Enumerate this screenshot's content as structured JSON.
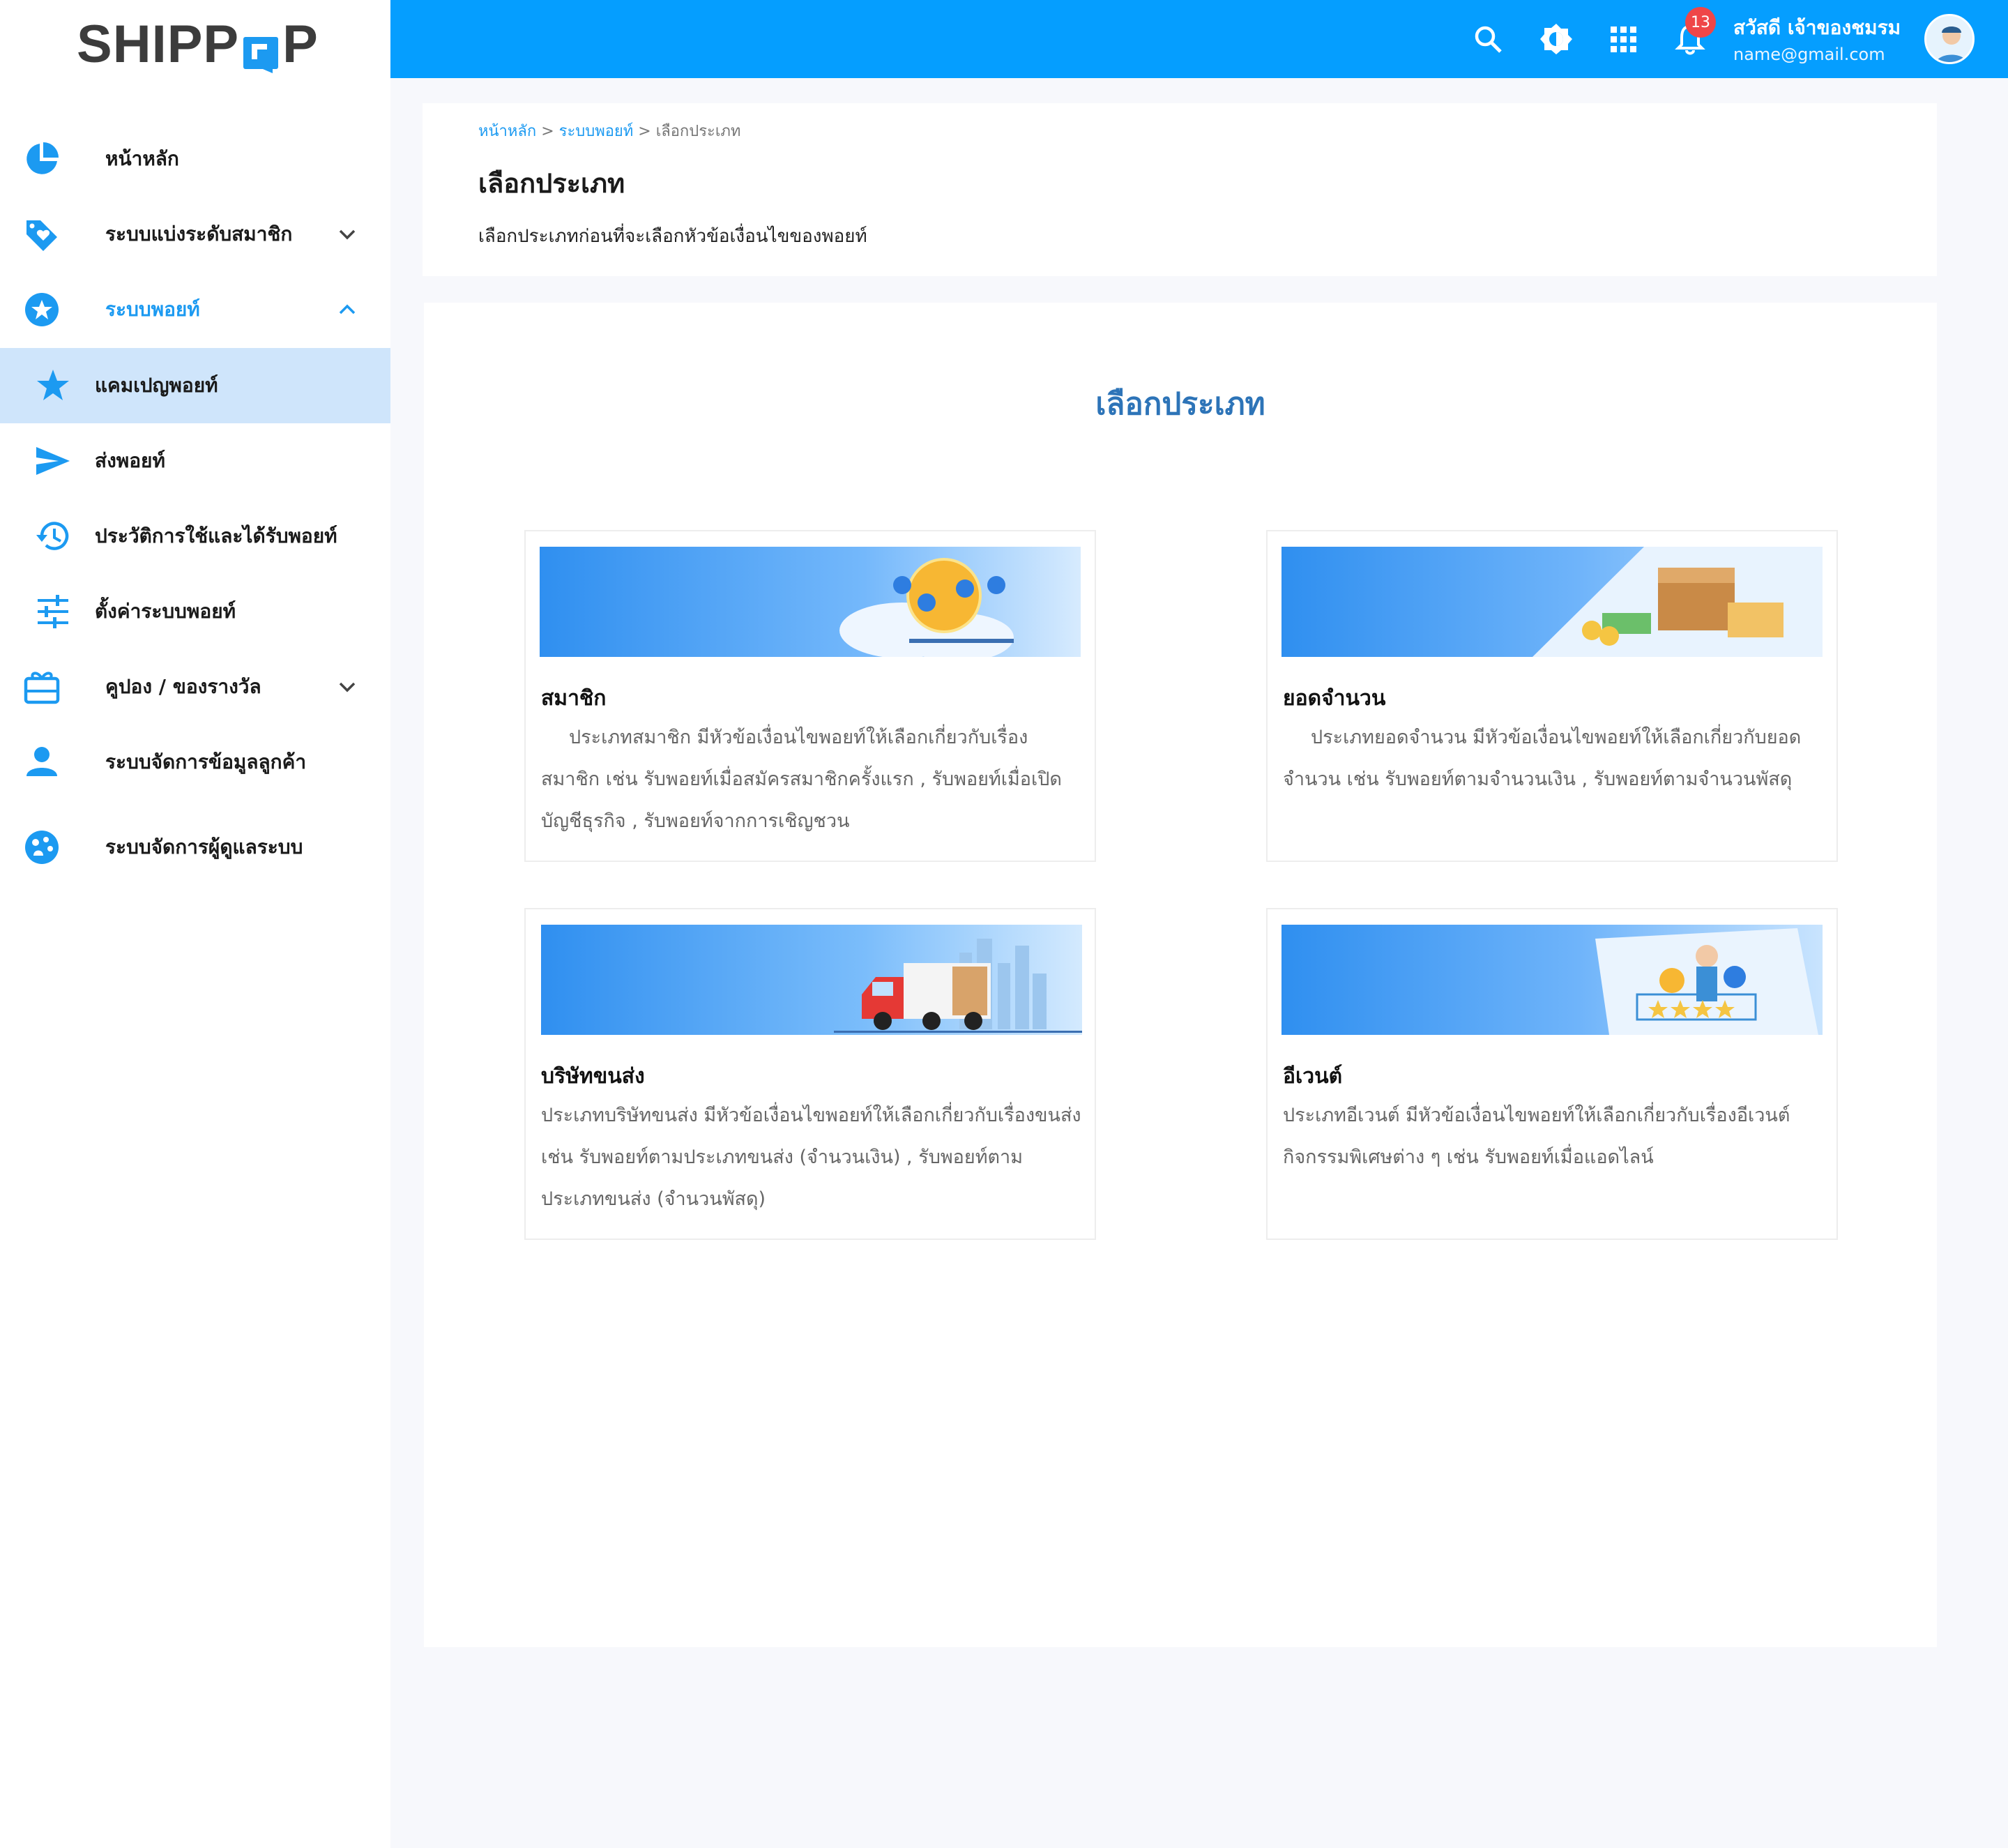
{
  "app": {
    "logo_text_left": "SHIPP",
    "logo_text_right": "P"
  },
  "sidebar": {
    "items": [
      {
        "label": "หน้าหลัก",
        "icon": "pie-chart-icon"
      },
      {
        "label": "ระบบแบ่งระดับสมาชิก",
        "icon": "heart-tag-icon",
        "expandable": true
      },
      {
        "label": "ระบบพอยท์",
        "icon": "star-circle-icon",
        "expanded": true
      },
      {
        "label": "แคมเปญพอยท์",
        "icon": "star-icon",
        "sub": true,
        "active": true
      },
      {
        "label": "ส่งพอยท์",
        "icon": "send-icon",
        "sub": true
      },
      {
        "label": "ประวัติการใช้และได้รับพอยท์",
        "icon": "history-icon",
        "sub": true
      },
      {
        "label": "ตั้งค่าระบบพอยท์",
        "icon": "sliders-icon",
        "sub": true
      },
      {
        "label": "คูปอง / ของรางวัล",
        "icon": "gift-card-icon",
        "expandable": true
      },
      {
        "label": "ระบบจัดการข้อมูลลูกค้า",
        "icon": "person-icon"
      },
      {
        "label": "ระบบจัดการผู้ดูแลระบบ",
        "icon": "admin-palette-icon"
      }
    ]
  },
  "topbar": {
    "icons": [
      "search-icon",
      "brightness-icon",
      "apps-grid-icon",
      "bell-icon"
    ],
    "notification_count": "13",
    "greeting": "สวัสดี เจ้าของชมรม",
    "email": "name@gmail.com"
  },
  "header": {
    "breadcrumb": {
      "home": "หน้าหลัก",
      "sep1": " > ",
      "section": "ระบบพอยท์",
      "sep2": " > ",
      "current": "เลือกประเภท"
    },
    "title": "เลือกประเภท",
    "description": "เลือกประเภทก่อนที่จะเลือกหัวข้อเงื่อนไขของพอยท์"
  },
  "main": {
    "title": "เลือกประเภท",
    "types": [
      {
        "name": "สมาชิก",
        "description": "ประเภทสมาชิก มีหัวข้อเงื่อนไขพอยท์ให้เลือกเกี่ยวกับเรื่องสมาชิก เช่น รับพอยท์เมื่อสมัครสมาชิกครั้งแรก , รับพอยท์เมื่อเปิดบัญชีธุรกิจ , รับพอยท์จากการเชิญชวน"
      },
      {
        "name": "ยอดจำนวน",
        "description": "ประเภทยอดจำนวน  มีหัวข้อเงื่อนไขพอยท์ให้เลือกเกี่ยวกับยอดจำนวน  เช่น รับพอยท์ตามจำนวนเงิน , รับพอยท์ตามจำนวนพัสดุ"
      },
      {
        "name": "บริษัทขนส่ง",
        "description": "ประเภทบริษัทขนส่ง มีหัวข้อเงื่อนไขพอยท์ให้เลือกเกี่ยวกับเรื่องขนส่ง เช่น รับพอยท์ตามประเภทขนส่ง (จำนวนเงิน) , รับพอยท์ตามประเภทขนส่ง (จำนวนพัสดุ)"
      },
      {
        "name": "อีเวนต์",
        "description": "ประเภทอีเวนต์ มีหัวข้อเงื่อนไขพอยท์ให้เลือกเกี่ยวกับเรื่องอีเวนต์ กิจกรรมพิเศษต่าง ๆ เช่น รับพอยท์เมื่อแอดไลน์"
      }
    ]
  },
  "colors": {
    "primary": "#059eff",
    "accent_text": "#1c9af1",
    "title_blue": "#2d74b8",
    "active_bg": "#cfe5fb",
    "badge_red": "#ef4648"
  }
}
